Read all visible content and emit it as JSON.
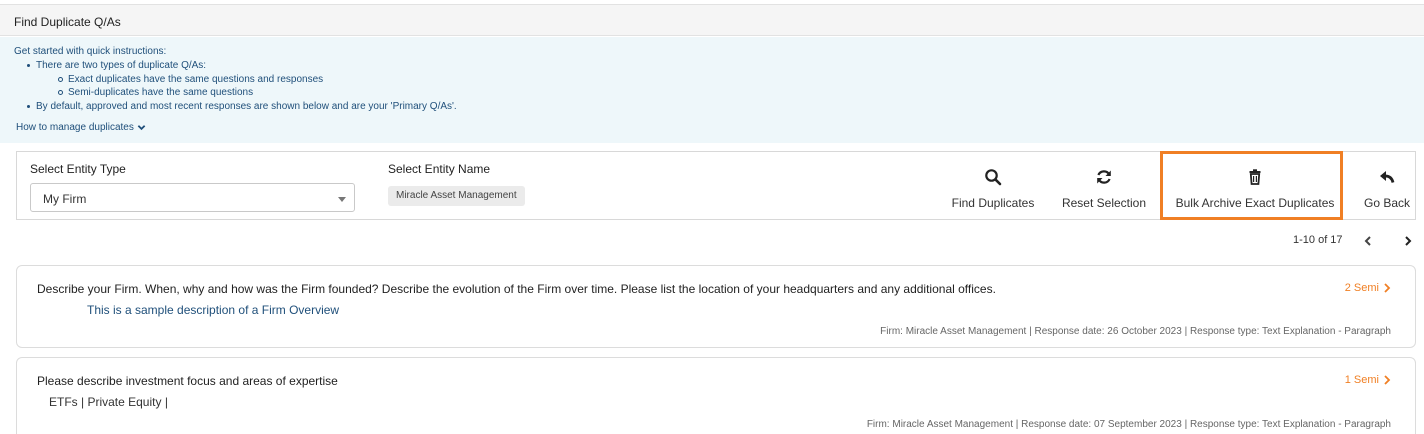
{
  "page_title": "Find Duplicate Q/As",
  "instructions": {
    "heading": "Get started with quick instructions:",
    "bullet_1": "There are two types of duplicate Q/As:",
    "sub_1": "Exact duplicates have the same questions and responses",
    "sub_2": "Semi-duplicates have the same questions",
    "bullet_2": "By default, approved and most recent responses are shown below and are your 'Primary Q/As'.",
    "howto_label": "How to manage duplicates"
  },
  "filters": {
    "entity_type_label": "Select Entity Type",
    "entity_type_value": "My Firm",
    "entity_name_label": "Select Entity Name",
    "entity_name_value": "Miracle Asset Management"
  },
  "actions": {
    "find": "Find Duplicates",
    "reset": "Reset Selection",
    "bulk_archive": "Bulk Archive Exact Duplicates",
    "go_back": "Go Back"
  },
  "pagination": {
    "range": "1-10 of 17"
  },
  "cards": [
    {
      "question": "Describe your Firm. When, why and how was the Firm founded? Describe the evolution of the Firm over time. Please list the location of your headquarters and any additional offices.",
      "response": "This is a sample description of a Firm Overview",
      "semi_count": "2 Semi",
      "meta": "Firm: Miracle Asset Management  |  Response date: 26 October 2023  |  Response type: Text Explanation - Paragraph"
    },
    {
      "question": "Please describe investment focus and areas of expertise",
      "response": "ETFs  |  Private Equity  |",
      "semi_count": "1 Semi",
      "meta": "Firm: Miracle Asset Management  |  Response date: 07 September 2023  |  Response type: Text Explanation - Paragraph"
    }
  ],
  "colors": {
    "accent": "#f07f24",
    "instruction_bg": "#eef7fa",
    "instruction_text": "#1f4f7a"
  },
  "icons": [
    "chevron-down-icon",
    "search-icon",
    "refresh-icon",
    "trash-icon",
    "reply-icon",
    "chevron-left-icon",
    "chevron-right-icon"
  ]
}
